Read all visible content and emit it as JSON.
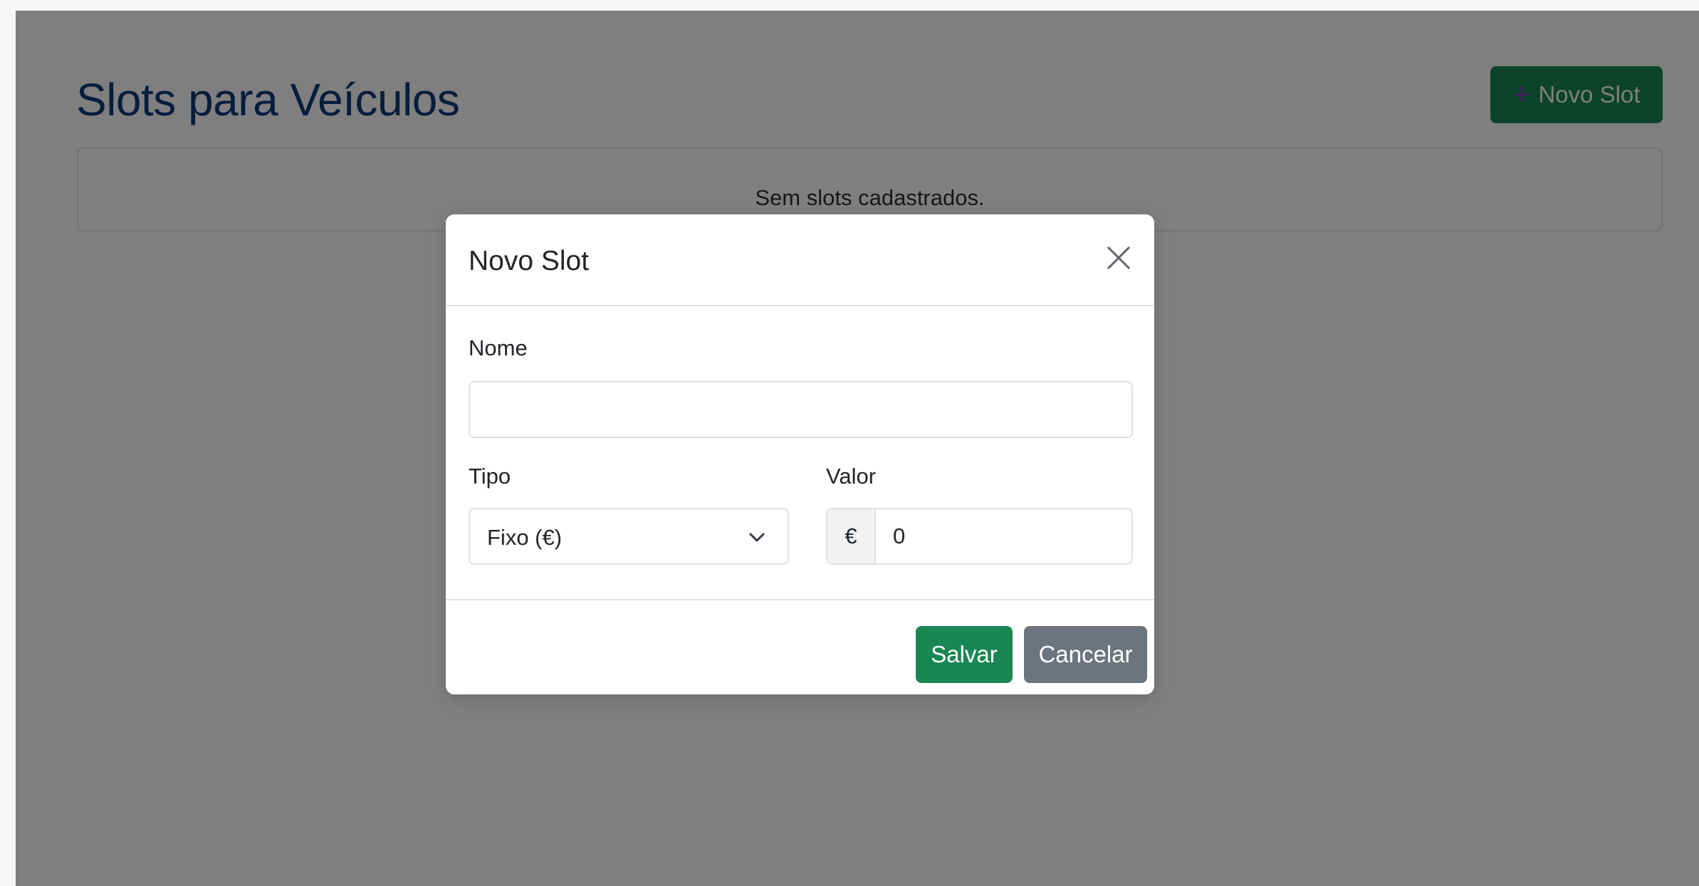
{
  "page": {
    "title": "Slots para Veículos",
    "new_button_label": "Novo Slot",
    "empty_message": "Sem slots cadastrados."
  },
  "modal": {
    "title": "Novo Slot",
    "fields": {
      "nome": {
        "label": "Nome",
        "value": "",
        "placeholder": ""
      },
      "tipo": {
        "label": "Tipo",
        "selected": "Fixo (€)"
      },
      "valor": {
        "label": "Valor",
        "prefix": "€",
        "value": "0"
      }
    },
    "buttons": {
      "save": "Salvar",
      "cancel": "Cancelar"
    }
  },
  "icons": {
    "plus": "plus-icon",
    "close": "close-icon",
    "chevron": "chevron-down-icon"
  },
  "colors": {
    "primary_green": "#198754",
    "secondary_gray": "#6c757d",
    "title_blue": "#0d3a78",
    "plus_icon": "#7b3fb8"
  }
}
